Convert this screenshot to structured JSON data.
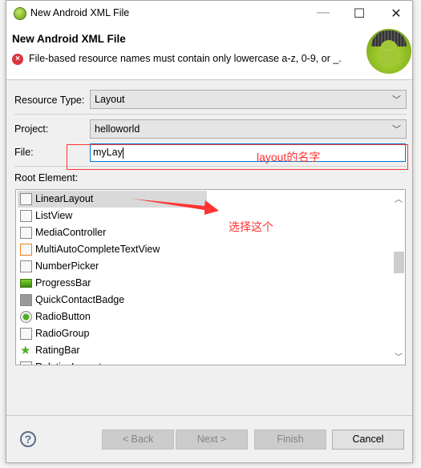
{
  "window": {
    "title": "New Android XML File",
    "minimize": "—",
    "maximize": "☐",
    "close": "✕"
  },
  "header": {
    "title": "New Android XML File",
    "error": "File-based resource names must contain only lowercase a-z, 0-9, or _."
  },
  "form": {
    "resource_type_label": "Resource Type:",
    "resource_type_value": "Layout",
    "project_label": "Project:",
    "project_value": "helloworld",
    "file_label": "File:",
    "file_value": "myLay",
    "root_element_label": "Root Element:"
  },
  "root_elements": [
    {
      "label": "LinearLayout",
      "icon": "linear-layout-icon",
      "selected": true
    },
    {
      "label": "ListView",
      "icon": "list-view-icon"
    },
    {
      "label": "MediaController",
      "icon": "media-controller-icon"
    },
    {
      "label": "MultiAutoCompleteTextView",
      "icon": "autocomplete-icon"
    },
    {
      "label": "NumberPicker",
      "icon": "number-picker-icon"
    },
    {
      "label": "ProgressBar",
      "icon": "progress-bar-icon"
    },
    {
      "label": "QuickContactBadge",
      "icon": "contact-badge-icon"
    },
    {
      "label": "RadioButton",
      "icon": "radio-button-icon"
    },
    {
      "label": "RadioGroup",
      "icon": "radio-group-icon"
    },
    {
      "label": "RatingBar",
      "icon": "rating-bar-icon"
    },
    {
      "label": "RelativeLayout",
      "icon": "relative-layout-icon"
    }
  ],
  "buttons": {
    "back": "< Back",
    "next": "Next >",
    "finish": "Finish",
    "cancel": "Cancel",
    "help": "?"
  },
  "annotations": {
    "file_note": "layout的名字",
    "select_note": "选择这个",
    "color": "#ff3333"
  }
}
